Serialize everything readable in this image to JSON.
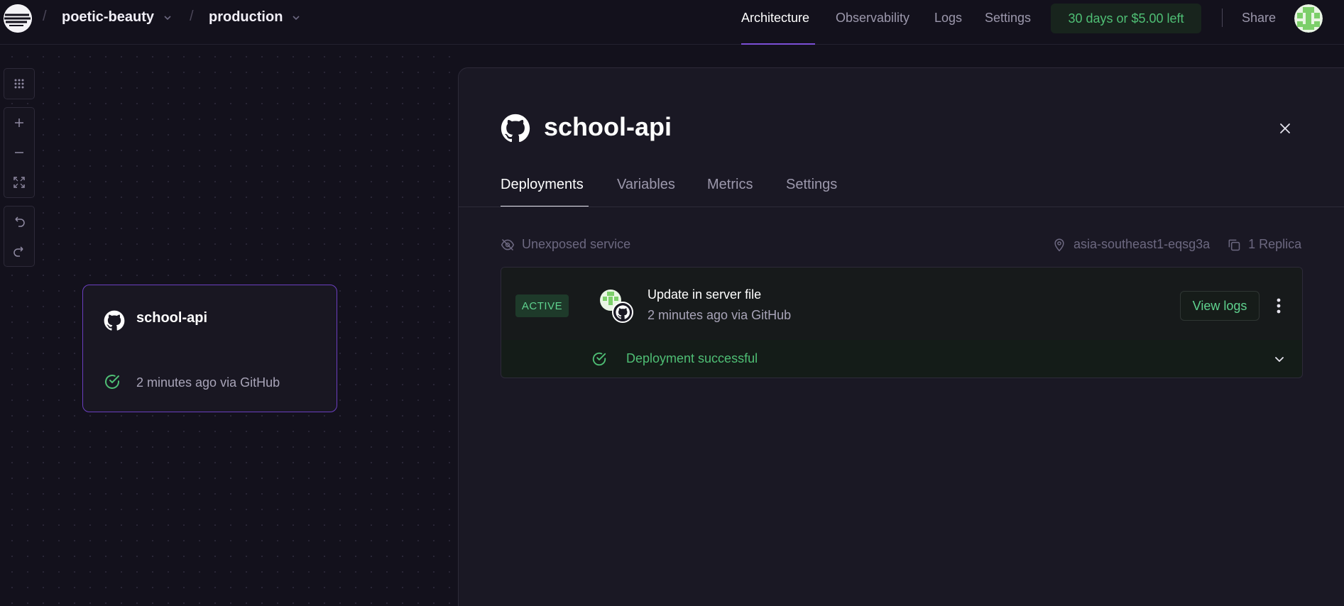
{
  "header": {
    "project_name": "poetic-beauty",
    "environment_name": "production",
    "nav": {
      "architecture": "Architecture",
      "observability": "Observability",
      "logs": "Logs",
      "settings": "Settings"
    },
    "trial": "30 days or $5.00 left",
    "share": "Share"
  },
  "canvas": {
    "service_card": {
      "name": "school-api",
      "meta": "2 minutes ago via GitHub"
    }
  },
  "panel": {
    "title": "school-api",
    "tabs": {
      "deployments": "Deployments",
      "variables": "Variables",
      "metrics": "Metrics",
      "settings": "Settings"
    },
    "exposure": "Unexposed service",
    "region": "asia-southeast1-eqsg3a",
    "replicas": "1 Replica",
    "deployment": {
      "status_badge": "ACTIVE",
      "commit_message": "Update in server file",
      "meta": "2 minutes ago via GitHub",
      "view_logs": "View logs",
      "result": "Deployment successful"
    }
  },
  "colors": {
    "background": "#13111c",
    "accent_purple": "#7b4fd6",
    "success_green": "#4fbf75"
  }
}
